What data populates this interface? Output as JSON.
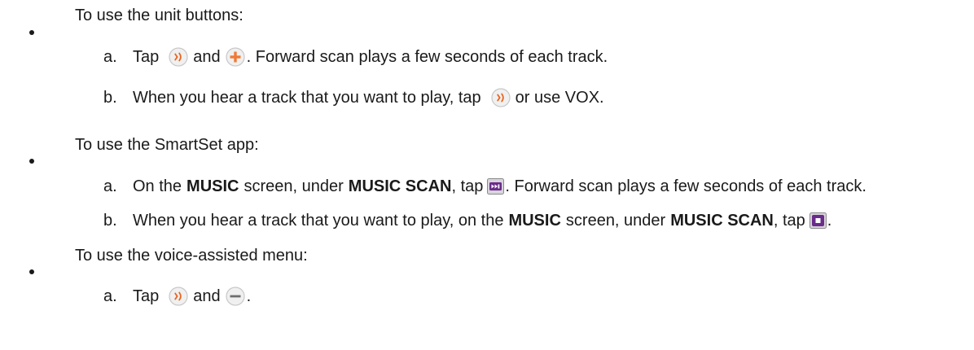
{
  "sections": [
    {
      "intro": "To use the unit buttons:",
      "steps": [
        {
          "marker": "a.",
          "t1": "Tap",
          "t2": "and",
          "t3": ". Forward scan plays a few seconds of each track."
        },
        {
          "marker": "b.",
          "t1": "When you hear a track that you want to play, tap",
          "t2": "or use VOX."
        }
      ]
    },
    {
      "intro": "To use the SmartSet app:",
      "steps": [
        {
          "marker": "a.",
          "t1": "On the",
          "b1": "MUSIC",
          "t2": "screen, under",
          "b2": "MUSIC SCAN",
          "t3": ", tap",
          "t4": ". Forward scan plays a few seconds of each track."
        },
        {
          "marker": "b.",
          "t1": "When you hear a track that you want to play, on the",
          "b1": "MUSIC",
          "t2": "screen, under",
          "b2": "MUSIC SCAN",
          "t3": ", tap",
          "t4": "."
        }
      ]
    },
    {
      "intro": "To use the voice-assisted menu:",
      "steps": [
        {
          "marker": "a.",
          "t1": "Tap",
          "t2": "and",
          "t3": "."
        }
      ]
    }
  ],
  "icons": {
    "voice_button": "voice-button-icon",
    "plus_button": "plus-button-icon",
    "minus_button": "minus-button-icon",
    "forward_scan": "forward-scan-icon",
    "stop_scan": "stop-scan-icon"
  },
  "colors": {
    "text": "#1a1a1a",
    "button_fill": "#f0f0f0",
    "button_ring": "#c8c8c8",
    "voice_accent": "#e8641e",
    "plus_accent": "#ef7a37",
    "scan_accent": "#6a2c8a"
  }
}
